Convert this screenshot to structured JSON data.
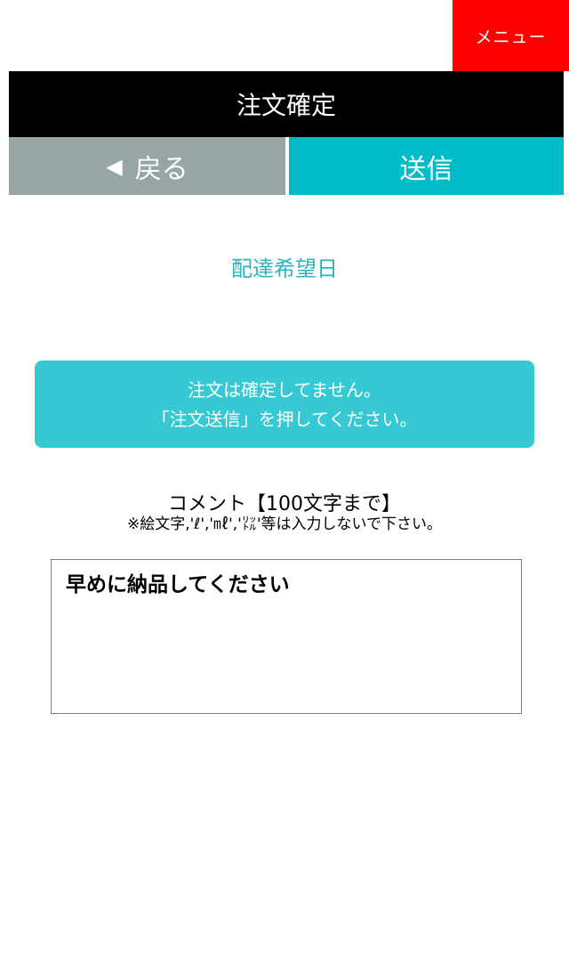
{
  "header": {
    "menu_label": "メニュー",
    "title": "注文確定"
  },
  "actions": {
    "back_icon": "◀",
    "back_label": "戻る",
    "send_label": "送信"
  },
  "delivery": {
    "label": "配達希望日"
  },
  "notice": {
    "line1": "注文は確定してません。",
    "line2": "「注文送信」を押してください。"
  },
  "comment": {
    "title": "コメント【100文字まで】",
    "note": "※絵文字,'ℓ','㎖','㍑'等は入力しないで下さい。",
    "value": "早めに納品してください"
  },
  "colors": {
    "menu_bg": "#ff0000",
    "title_bg": "#000000",
    "back_bg": "#97a5a5",
    "send_bg": "#00bcc8",
    "accent_text": "#2bb3c0",
    "notice_bg": "#36c9d3"
  }
}
